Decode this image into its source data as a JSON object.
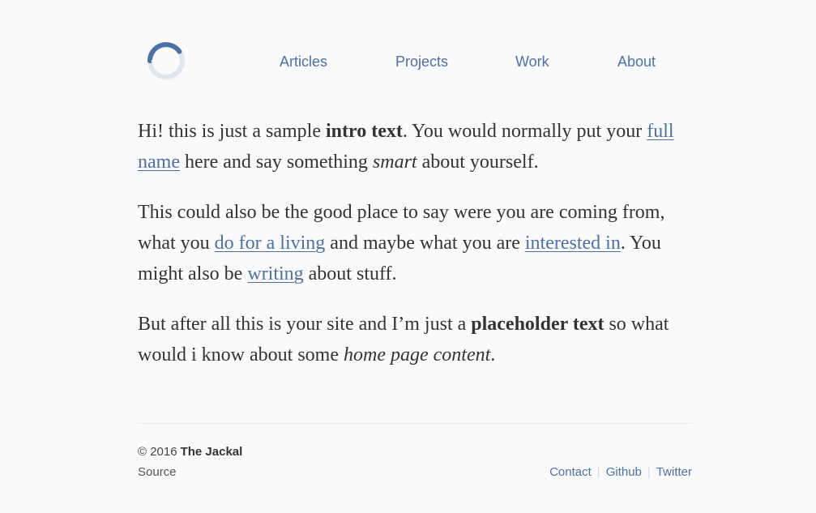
{
  "logo": {
    "icon": "c-circle-logo-icon",
    "colors": {
      "arc": "#4a72a8",
      "track": "#dfe6f1"
    }
  },
  "nav": {
    "items": [
      {
        "label": "Articles"
      },
      {
        "label": "Projects"
      },
      {
        "label": "Work"
      },
      {
        "label": "About"
      }
    ]
  },
  "intro": {
    "p1": {
      "t1": "Hi! this is just a sample ",
      "bold1": "intro text",
      "t2": ". You would normally put your ",
      "link1": "full name",
      "t3": " here and say something ",
      "em1": "smart",
      "t4": " about yourself."
    },
    "p2": {
      "t1": "This could also be the good place to say were you are coming from, what you ",
      "link1": "do for a living",
      "t2": " and maybe what you are ",
      "link2": "interested in",
      "t3": ". You might also be ",
      "link3": "writing",
      "t4": " about stuff."
    },
    "p3": {
      "t1": "But after all this is your site and I’m just a ",
      "bold1": "placeholder text",
      "t2": " so what would i know about some ",
      "em1": "home page content",
      "t3": "."
    }
  },
  "footer": {
    "copyright": "© 2016",
    "author": "The Jackal",
    "source": "Source",
    "links": [
      {
        "label": "Contact"
      },
      {
        "label": "Github"
      },
      {
        "label": "Twitter"
      }
    ]
  },
  "colors": {
    "accent": "#4a72a8",
    "text": "#333333",
    "background": "#fafafa"
  }
}
